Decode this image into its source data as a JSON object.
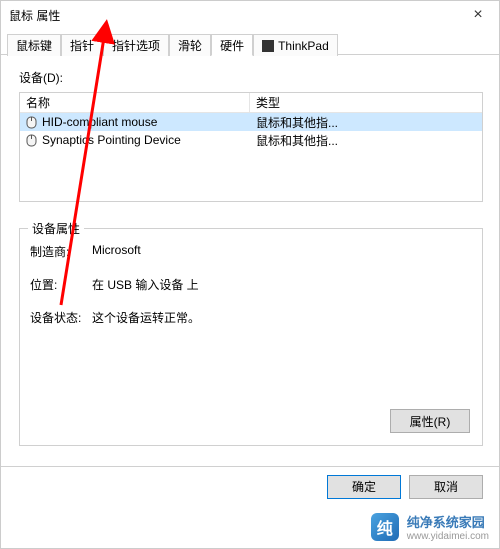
{
  "window": {
    "title": "鼠标 属性"
  },
  "tabs": {
    "items": [
      {
        "label": "鼠标键"
      },
      {
        "label": "指针"
      },
      {
        "label": "指针选项"
      },
      {
        "label": "滑轮"
      },
      {
        "label": "硬件"
      },
      {
        "label": "ThinkPad"
      }
    ],
    "active_index": 4
  },
  "devices": {
    "section_label": "设备(D):",
    "columns": {
      "name": "名称",
      "type": "类型"
    },
    "rows": [
      {
        "name": "HID-compliant mouse",
        "type": "鼠标和其他指...",
        "selected": true
      },
      {
        "name": "Synaptics Pointing Device",
        "type": "鼠标和其他指...",
        "selected": false
      }
    ]
  },
  "props": {
    "group_title": "设备属性",
    "manufacturer_label": "制造商:",
    "manufacturer_value": "Microsoft",
    "location_label": "位置:",
    "location_value": "在 USB 输入设备 上",
    "status_label": "设备状态:",
    "status_value": "这个设备运转正常。",
    "properties_button": "属性(R)"
  },
  "buttons": {
    "ok": "确定",
    "cancel": "取消"
  },
  "watermark": {
    "title": "纯净系统家园",
    "url": "www.yidaimei.com"
  }
}
